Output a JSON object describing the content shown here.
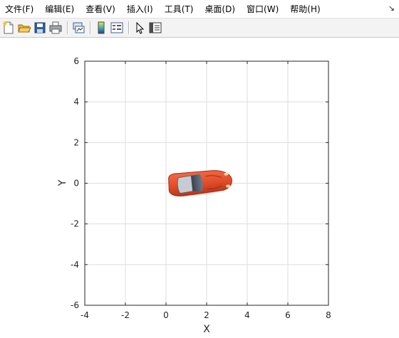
{
  "menubar": {
    "items": [
      {
        "label": "文件(F)",
        "name": "menu-file"
      },
      {
        "label": "编辑(E)",
        "name": "menu-edit"
      },
      {
        "label": "查看(V)",
        "name": "menu-view"
      },
      {
        "label": "插入(I)",
        "name": "menu-insert"
      },
      {
        "label": "工具(T)",
        "name": "menu-tools"
      },
      {
        "label": "桌面(D)",
        "name": "menu-desktop"
      },
      {
        "label": "窗口(W)",
        "name": "menu-window"
      },
      {
        "label": "帮助(H)",
        "name": "menu-help"
      }
    ],
    "dock_glyph": "↘"
  },
  "toolbar": {
    "buttons": [
      {
        "name": "new-figure-icon",
        "interactable": true
      },
      {
        "name": "open-file-icon",
        "interactable": true
      },
      {
        "name": "save-icon",
        "interactable": true
      },
      {
        "name": "print-icon",
        "interactable": true
      },
      {
        "name": "link-plot-icon",
        "interactable": true
      },
      {
        "name": "colorbar-icon",
        "interactable": true
      },
      {
        "name": "legend-icon",
        "interactable": true
      },
      {
        "name": "pointer-icon",
        "interactable": true
      },
      {
        "name": "property-inspector-icon",
        "interactable": true
      }
    ]
  },
  "colors": {
    "grid": "#dedede",
    "axes": "#262626",
    "car_body": "#e14d28",
    "car_dark": "#a52a12"
  },
  "chart_data": {
    "type": "scatter",
    "xlabel": "X",
    "ylabel": "Y",
    "xlim": [
      -4,
      8
    ],
    "ylim": [
      -6,
      6
    ],
    "xticks": [
      -4,
      -2,
      0,
      2,
      4,
      6,
      8
    ],
    "yticks": [
      -6,
      -4,
      -2,
      0,
      2,
      4,
      6
    ],
    "grid": true,
    "marker": "car-image",
    "points": [
      {
        "x": 1.7,
        "y": 0
      }
    ]
  }
}
